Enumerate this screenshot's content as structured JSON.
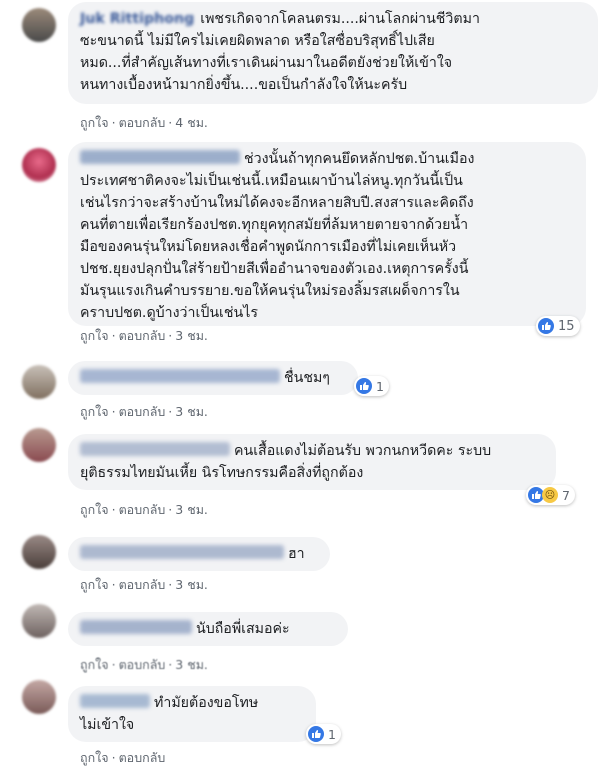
{
  "comments": [
    {
      "author": "Juk Rittiphong",
      "text": "เพชรเกิดจากโคลนตรม....ผ่านโลกผ่านชีวิตมา\nซะขนาดนี้ ไม่มีใครไม่เคยผิดพลาด หรือใสซื่อบริสุทธิ์ไปเสีย\nหมด...ที่สำคัญเส้นทางที่เราเดินผ่านมาในอดีตยังช่วยให้เข้าใจ\nหนทางเบื้องหน้ามากยิ่งขึ้น....ขอเป็นกำลังใจให้นะครับ",
      "like": "ถูกใจ",
      "reply": "ตอบกลับ",
      "time": "4 ชม."
    },
    {
      "author": "",
      "text": "ช่วงนั้นถ้าทุกคนยึดหลักปชต.บ้านเมือง\nประเทศชาติคงจะไม่เป็นเช่นนี้.เหมือนเผาบ้านไล่หนู.ทุกวันนี้เป็น\nเช่นไรกว่าจะสร้างบ้านใหม่ได้คงจะอีกหลายสิบปี.สงสารและคิดถึง\nคนที่ตายเพื่อเรียกร้องปชต.ทุกยุคทุกสมัยที่ล้มหายตายจากด้วยน้ำ\nมือของคนรุ่นใหม่โดยหลงเชื่อคำพูดนักการเมืองที่ไม่เคยเห็นหัว\nปชช.ยุยงปลุกปั่นใส่ร้ายป้ายสีเพื่ออำนาจของตัวเอง.เหตุการครั้งนี้\nมันรุนแรงเกินคำบรรยาย.ขอให้คนรุ่นใหม่รองลิ้มรสเผด็จการใน\nคราบปชต.ดูบ้างว่าเป็นเช่นไร",
      "like": "ถูกใจ",
      "reply": "ตอบกลับ",
      "time": "3 ชม.",
      "reaction_count": "15"
    },
    {
      "author": "",
      "text": "ชื่นชมๆ",
      "like": "ถูกใจ",
      "reply": "ตอบกลับ",
      "time": "3 ชม.",
      "reaction_count": "1"
    },
    {
      "author": "",
      "text": "คนเสื้อแดงไม่ต้อนรับ พวกนกหวีดคะ ระบบ\nยุติธรรมไทยมันเหี้ย นิรโทษกรรมคือสิ่งที่ถูกต้อง",
      "like": "ถูกใจ",
      "reply": "ตอบกลับ",
      "time": "3 ชม.",
      "reaction_count": "7"
    },
    {
      "author": "",
      "text": "ฮา",
      "like": "ถูกใจ",
      "reply": "ตอบกลับ",
      "time": "3 ชม."
    },
    {
      "author": "",
      "text": "นับถือพี่เสมอค่ะ",
      "like": "ถูกใจ",
      "reply": "ตอบกลับ",
      "time": "3 ชม."
    },
    {
      "author": "",
      "text": "ทำมัยต้องขอโทษ\nไม่เข้าใจ",
      "like": "ถูกใจ",
      "reply": "ตอบกลับ",
      "time": "",
      "reaction_count": "1"
    }
  ],
  "colors": {
    "bubble": "#f2f3f5",
    "link": "#385898",
    "meta": "#606770",
    "like_blue": "#3578e5"
  }
}
